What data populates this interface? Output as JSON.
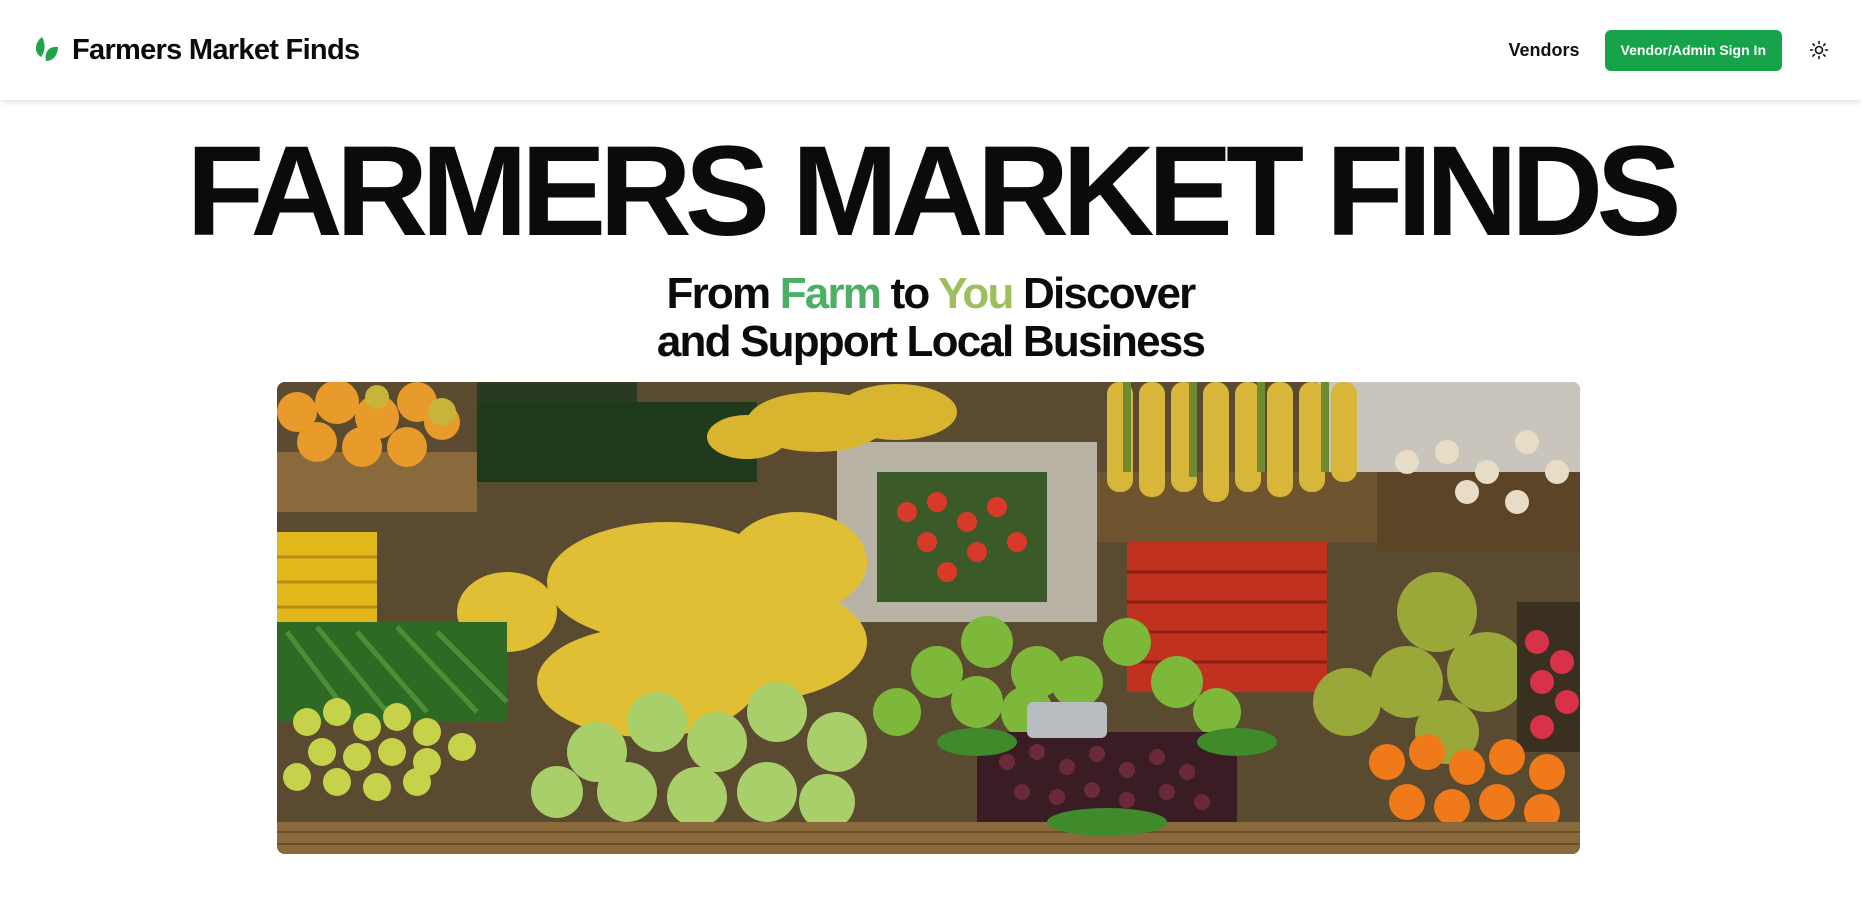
{
  "nav": {
    "brand_name": "Farmers Market Finds",
    "brand_icon": "leaf-icon",
    "links": {
      "vendors": "Vendors"
    },
    "signin_label": "Vendor/Admin Sign In",
    "theme_icon": "sun-icon"
  },
  "hero": {
    "title": "FARMERS MARKET FINDS",
    "tagline": {
      "part1": "From ",
      "farm": "Farm",
      "part2": " to ",
      "you": "You",
      "part3": " Discover",
      "line2": "and Support Local Business"
    },
    "image_alt": "produce-stall-photo"
  },
  "colors": {
    "accent": "#16a34a",
    "farm": "#4caf66",
    "you": "#9fbf5f",
    "text": "#0b0b0b"
  }
}
